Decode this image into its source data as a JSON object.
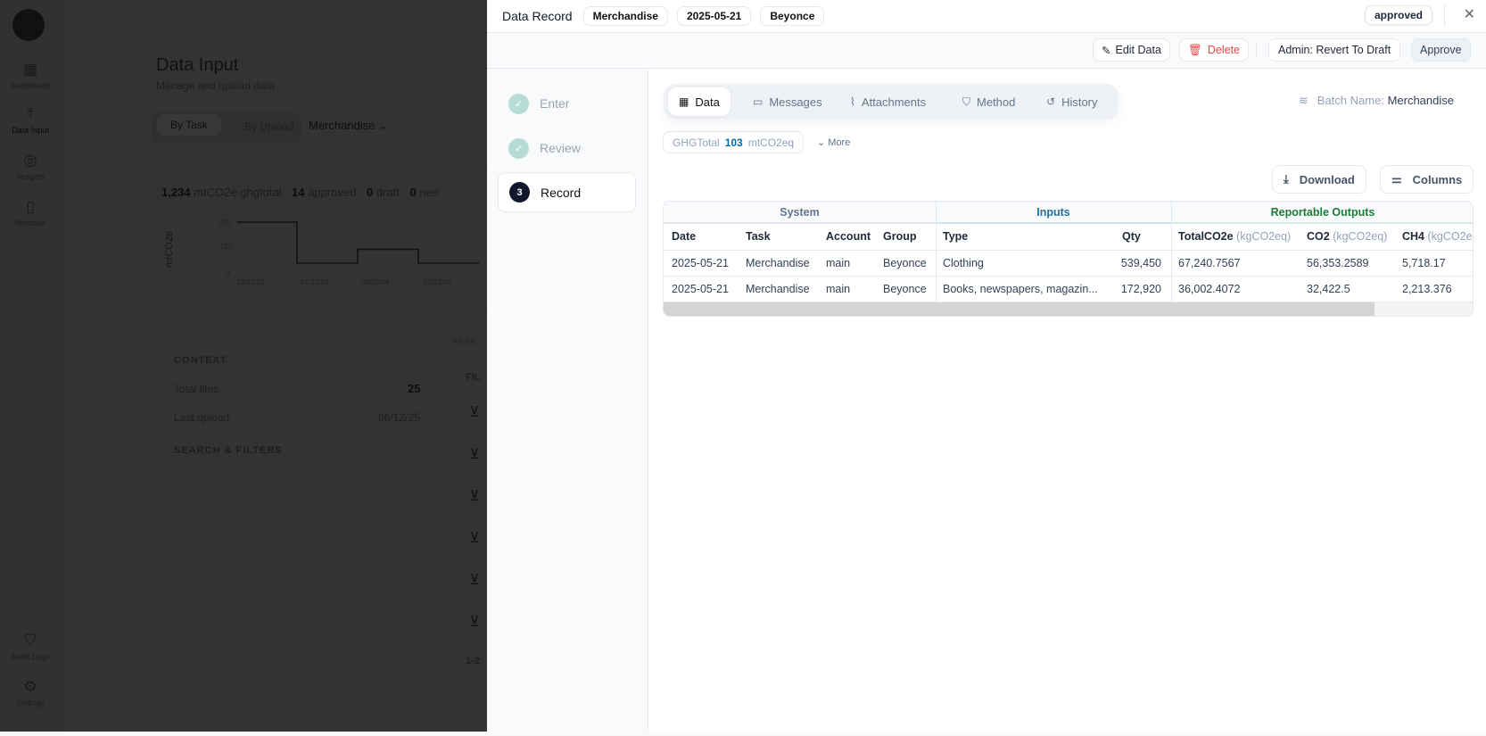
{
  "background": {
    "nav": [
      {
        "label": "Dashboard",
        "icon": "grid-icon"
      },
      {
        "label": "Data Input",
        "icon": "upload-icon"
      },
      {
        "label": "Insights",
        "icon": "compass-icon"
      },
      {
        "label": "Methods",
        "icon": "book-icon"
      },
      {
        "label": "Audit Logs",
        "icon": "shield-check-icon"
      },
      {
        "label": "Settings",
        "icon": "gear-icon"
      }
    ],
    "title": "Data Input",
    "subtitle": "Manage and upload data",
    "view_tabs": [
      "By Task",
      "By Upload"
    ],
    "task_select": "Merchandise",
    "stats": {
      "total": "1,234",
      "total_unit": "mtCO2e ghgtotal",
      "approved": "14",
      "approved_label": "approved",
      "draft": "0",
      "draft_label": "draft",
      "needs": "0",
      "needs_label": "nee"
    },
    "chart_data": {
      "type": "line",
      "ylabel": "mtCO2e",
      "yticks": [
        "220",
        "110",
        "0"
      ],
      "x": [
        "12/31/23",
        "01/31/24",
        "02/29/24",
        "03/31/24"
      ],
      "values": [
        220,
        40,
        100,
        40
      ]
    },
    "context": {
      "heading": "CONTEXT",
      "total_files_label": "Total files",
      "total_files": "25",
      "last_upload_label": "Last upload",
      "last_upload": "06/12/25",
      "filters": "SEARCH & FILTERS"
    },
    "files_heading": "FILES",
    "files_col": "FIL",
    "pager": "1-2"
  },
  "panel": {
    "title": "Data Record",
    "chips": [
      "Merchandise",
      "2025-05-21",
      "Beyonce"
    ],
    "status": "approved",
    "actions": {
      "edit": "Edit Data",
      "delete": "Delete",
      "revert": "Admin: Revert To Draft",
      "approve": "Approve"
    },
    "steps": [
      {
        "n": "✓",
        "label": "Enter"
      },
      {
        "n": "✓",
        "label": "Review"
      },
      {
        "n": "3",
        "label": "Record"
      }
    ],
    "tabs": [
      "Data",
      "Messages",
      "Attachments",
      "Method",
      "History"
    ],
    "batch_label": "Batch Name:",
    "batch_value": "Merchandise",
    "ghg": {
      "label": "GHGTotal",
      "value": "103",
      "unit": "mtCO2eq"
    },
    "more": "More",
    "download": "Download",
    "columns": "Columns",
    "table": {
      "groups": {
        "system": "System",
        "inputs": "Inputs",
        "outputs": "Reportable Outputs"
      },
      "headers": {
        "date": "Date",
        "task": "Task",
        "account": "Account",
        "group": "Group",
        "type": "Type",
        "qty": "Qty",
        "total": "TotalCO2e",
        "co2": "CO2",
        "ch4": "CH4",
        "unit": "(kgCO2eq)",
        "unit_cut": "(kgCO2e"
      },
      "rows": [
        {
          "date": "2025-05-21",
          "task": "Merchandise",
          "account": "main",
          "group": "Beyonce",
          "type": "Clothing",
          "qty": "539,450",
          "total": "67,240.7567",
          "co2": "56,353.2589",
          "ch4": "5,718.17"
        },
        {
          "date": "2025-05-21",
          "task": "Merchandise",
          "account": "main",
          "group": "Beyonce",
          "type": "Books, newspapers, magazin...",
          "qty": "172,920",
          "total": "36,002.4072",
          "co2": "32,422.5",
          "ch4": "2,213.376"
        }
      ]
    }
  },
  "colors": {
    "inputs": "#1d6fa5",
    "outputs": "#1f7a3a",
    "delete": "#ef4444",
    "accent": "#0369a1"
  }
}
